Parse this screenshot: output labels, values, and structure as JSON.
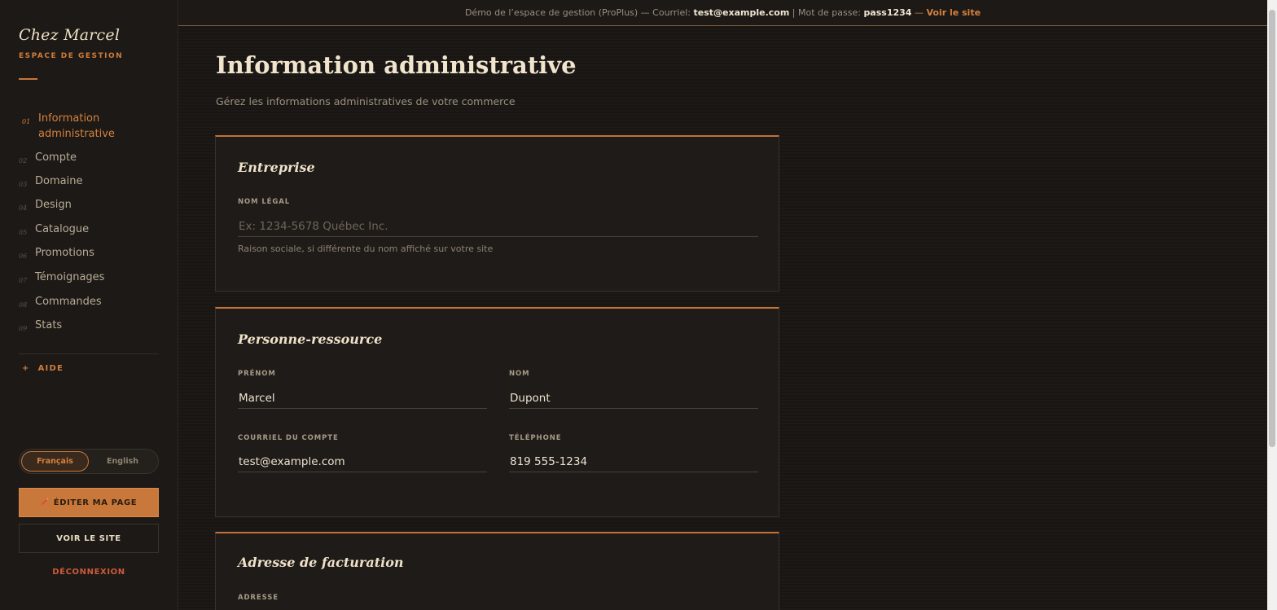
{
  "banner": {
    "prefix": "Démo de l’espace de gestion (ProPlus) — Courriel:",
    "email": "test@example.com",
    "sep": "| Mot de passe:",
    "password": "pass1234",
    "dash": "—",
    "link": "Voir le site"
  },
  "sidebar": {
    "brand": "Chez Marcel",
    "subtitle": "ESPACE DE GESTION",
    "items": [
      {
        "num": "01",
        "label": "Information administrative"
      },
      {
        "num": "02",
        "label": "Compte"
      },
      {
        "num": "03",
        "label": "Domaine"
      },
      {
        "num": "04",
        "label": "Design"
      },
      {
        "num": "05",
        "label": "Catalogue"
      },
      {
        "num": "06",
        "label": "Promotions"
      },
      {
        "num": "07",
        "label": "Témoignages"
      },
      {
        "num": "08",
        "label": "Commandes"
      },
      {
        "num": "09",
        "label": "Stats"
      }
    ],
    "help_plus": "+",
    "help": "AIDE",
    "lang_fr": "Français",
    "lang_en": "English",
    "edit_button": "ÉDITER MA PAGE",
    "view_button": "VOIR LE SITE",
    "logout": "DÉCONNEXION"
  },
  "main": {
    "title": "Information administrative",
    "subtitle": "Gérez les informations administratives de votre commerce",
    "entreprise": {
      "title": "Entreprise",
      "legal_label": "NOM LÉGAL",
      "legal_placeholder": "Ex: 1234-5678 Québec Inc.",
      "legal_hint": "Raison sociale, si différente du nom affiché sur votre site"
    },
    "contact": {
      "title": "Personne-ressource",
      "firstname_label": "PRÉNOM",
      "firstname": "Marcel",
      "lastname_label": "NOM",
      "lastname": "Dupont",
      "email_label": "COURRIEL DU COMPTE",
      "email": "test@example.com",
      "phone_label": "TÉLÉPHONE",
      "phone": "819 555-1234"
    },
    "billing": {
      "title": "Adresse de facturation",
      "address_label": "ADRESSE"
    }
  },
  "colors": {
    "accent": "#c9783b",
    "background": "#1a1715",
    "danger": "#cc5a3a"
  },
  "icons": {
    "edit": "pencil-icon"
  }
}
